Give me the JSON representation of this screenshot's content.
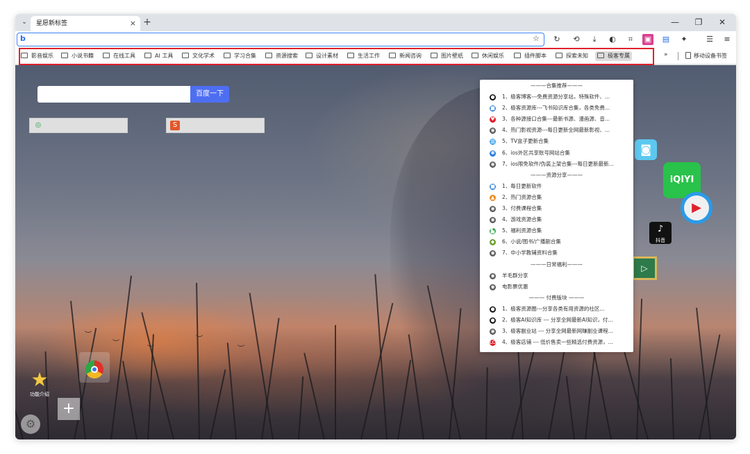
{
  "tab": {
    "title": "星愿新标签",
    "close": "×",
    "new_tab": "+",
    "menu": "⌄"
  },
  "window_controls": {
    "minimize": "—",
    "restore": "❐",
    "close": "✕"
  },
  "address": {
    "logo": "b",
    "star": "☆"
  },
  "toolbar_icons": [
    "↻",
    "⟲",
    "⤓",
    "◐",
    "⌗",
    "▣",
    "▤",
    "✦",
    "☰",
    "≡"
  ],
  "bookmarks": [
    "影音娱乐",
    "小说书籍",
    "在线工具",
    "AI 工具",
    "文化学术",
    "学习合集",
    "资源搜索",
    "设计素材",
    "生活工作",
    "新闻咨询",
    "图片壁纸",
    "休闲娱乐",
    "插件脚本",
    "探索未知",
    "极客专属"
  ],
  "bookmarks_more": "»",
  "mobile_bookmarks": "移动设备书签",
  "search": {
    "button": "百度一下"
  },
  "apps": {
    "intro_label": "功能介绍",
    "douyin_label": "抖音",
    "iqiyi": "iQIYI"
  },
  "dropdown": {
    "sections": [
      {
        "header": "———合集推荐———",
        "items": [
          {
            "icon": "●",
            "color": "#111111",
            "text": "1、极客博客---免费资源分享站，特殊软件、..."
          },
          {
            "icon": "■",
            "color": "#3a86d8",
            "text": "2、极客资源库---飞书知识库合集，各类免费..."
          },
          {
            "icon": "♥",
            "color": "#e0202a",
            "text": "3、各种源接口合集---最新书源、漫画源、音..."
          },
          {
            "icon": "◉",
            "color": "#555555",
            "text": "4、热门影视资源---每日更新全网最新影视、..."
          },
          {
            "icon": "▥",
            "color": "#3aa0e8",
            "text": "5、TV盒子更新合集"
          },
          {
            "icon": "✽",
            "color": "#2a7be0",
            "text": "6、ios外区共享账号网站合集"
          },
          {
            "icon": "◉",
            "color": "#555555",
            "text": "7、ios限免软件/伪装上架合集---每日更新最新..."
          }
        ]
      },
      {
        "header": "———资源分享———",
        "items": [
          {
            "icon": "■",
            "color": "#3a86d8",
            "text": "1、每日更新软件"
          },
          {
            "icon": "▲",
            "color": "#f08a1a",
            "text": "2、热门资源合集"
          },
          {
            "icon": "◉",
            "color": "#555555",
            "text": "3、付费课程合集"
          },
          {
            "icon": "◉",
            "color": "#555555",
            "text": "4、游戏资源合集"
          },
          {
            "icon": "▙",
            "color": "#2aa844",
            "text": "5、福利资源合集"
          },
          {
            "icon": "◆",
            "color": "#6a9e2a",
            "text": "6、小说/图书/广播剧合集"
          },
          {
            "icon": "◉",
            "color": "#555555",
            "text": "7、中小学教辅资料合集"
          }
        ]
      },
      {
        "header": "———日常福利———",
        "items": [
          {
            "icon": "◉",
            "color": "#555555",
            "text": "羊毛群分享"
          },
          {
            "icon": "◉",
            "color": "#555555",
            "text": "电影票优惠"
          }
        ]
      },
      {
        "header": "——— 付费版块 ———",
        "items": [
          {
            "icon": "●",
            "color": "#111111",
            "text": "1、极客资源圈---分享各类有用资源的社区..."
          },
          {
            "icon": "●",
            "color": "#111111",
            "text": "2、极客AI知识库 --- 分享全网最新AI知识，付..."
          },
          {
            "icon": "◉",
            "color": "#555555",
            "text": "3、极客副业站 --- 分享全网最新网赚副业课程..."
          },
          {
            "icon": "LO",
            "color": "#e0202a",
            "text": "4、极客店铺 --- 低价售卖一些精选付费资源，..."
          }
        ]
      }
    ]
  }
}
